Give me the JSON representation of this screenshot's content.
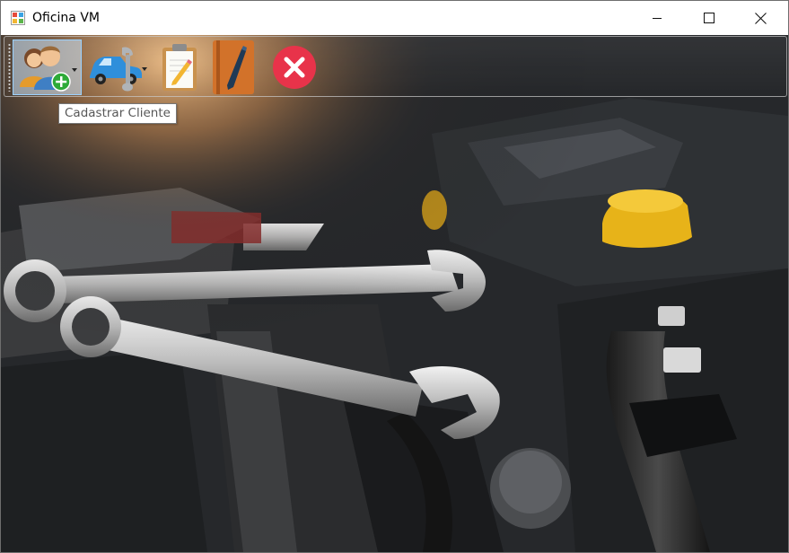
{
  "window": {
    "title": "Oficina VM",
    "app_icon": "windows-form-icon",
    "controls": [
      "minimize-icon",
      "maximize-icon",
      "close-icon"
    ]
  },
  "toolbar": {
    "buttons": [
      {
        "icon": "add-client-icon",
        "has_dropdown": true,
        "selected": true
      },
      {
        "icon": "car-service-icon",
        "has_dropdown": true,
        "selected": false
      },
      {
        "icon": "clipboard-pencil-icon",
        "has_dropdown": false,
        "selected": false
      },
      {
        "icon": "notebook-pen-icon",
        "has_dropdown": false,
        "selected": false
      },
      {
        "icon": "exit-icon",
        "has_dropdown": false,
        "selected": false
      }
    ],
    "tooltip": "Cadastrar Cliente"
  },
  "background": {
    "description_icon": "car-engine-wrenches-photo"
  },
  "colors": {
    "exit_red": "#e8334a",
    "client_green": "#2eaa38",
    "car_blue": "#2f8fdb",
    "book_orange": "#d2722a"
  }
}
